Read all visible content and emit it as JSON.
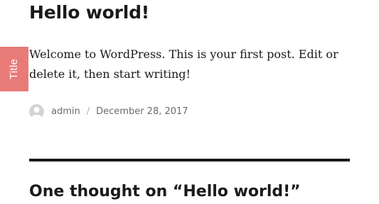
{
  "post": {
    "title": "Hello world!",
    "content": "Welcome to WordPress. This is your first post. Edit or delete it, then start writing!",
    "author": "admin",
    "separator": "/",
    "date": "December 28, 2017"
  },
  "side_tab": {
    "label": "Title",
    "color": "#e87a78"
  },
  "comments": {
    "title": "One thought on “Hello world!”"
  },
  "icons": {
    "avatar": "user-avatar-placeholder-icon"
  }
}
